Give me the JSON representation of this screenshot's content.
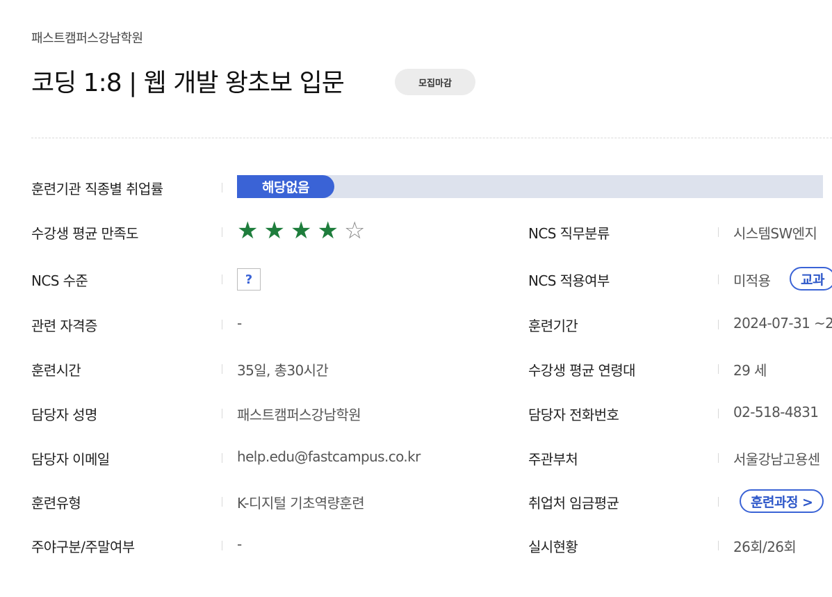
{
  "header": {
    "org": "패스트캠퍼스강남학원",
    "title": "코딩 1:8 | 웹 개발 왕초보 입문",
    "badge": "모집마감"
  },
  "employment_rate": {
    "label": "훈련기관 직종별 취업률",
    "value": "해당없음"
  },
  "satisfaction": {
    "label": "수강생 평균 만족도",
    "stars_filled": 4,
    "stars_total": 5
  },
  "left": {
    "ncs_level_label": "NCS 수준",
    "ncs_level_value": "?",
    "cert_label": "관련 자격증",
    "cert_value": "-",
    "hours_label": "훈련시간",
    "hours_value": "35일, 총30시간",
    "manager_label": "담당자 성명",
    "manager_value": "패스트캠퍼스강남학원",
    "email_label": "담당자 이메일",
    "email_value": "help.edu@fastcampus.co.kr",
    "type_label": "훈련유형",
    "type_value": "K-디지털 기초역량훈련",
    "daynight_label": "주야구분/주말여부",
    "daynight_value": "-"
  },
  "right": {
    "ncs_class_label": "NCS 직무분류",
    "ncs_class_value": "시스템SW엔지",
    "ncs_apply_label": "NCS 적용여부",
    "ncs_apply_value": "미적용",
    "ncs_apply_button": "교과",
    "period_label": "훈련기간",
    "period_value": "2024-07-31 ~2",
    "age_label": "수강생 평균 연령대",
    "age_value": "29 세",
    "phone_label": "담당자 전화번호",
    "phone_value": "02-518-4831",
    "dept_label": "주관부처",
    "dept_value": "서울강남고용센",
    "wage_label": "취업처 임금평균",
    "wage_button": "훈련과정 >",
    "status_label": "실시현황",
    "status_value": "26회/26회"
  },
  "colors": {
    "accent": "#3a63d6",
    "star": "#1e7d3c",
    "bar_bg": "#dde2ed"
  }
}
